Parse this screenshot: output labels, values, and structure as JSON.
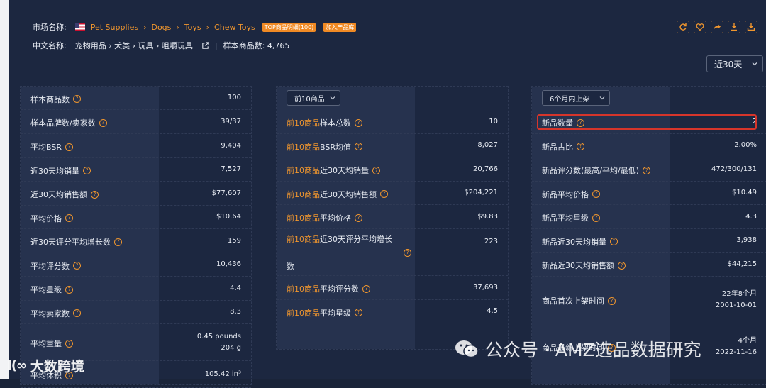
{
  "header": {
    "market_label": "市场名称:",
    "crumbs": [
      "Pet Supplies",
      "Dogs",
      "Toys",
      "Chew Toys"
    ],
    "crumb_sep": "›",
    "badge_top": "TOP商品明细(100)",
    "badge_add": "加入产品库",
    "cn_label": "中文名称:",
    "cn_path": "宠物用品 › 犬类 › 玩具 › 咀嚼玩具",
    "divider": "|",
    "sample_count_label": "样本商品数: 4,765"
  },
  "tools": [
    "refresh-icon",
    "heart-icon",
    "share-icon",
    "download-icon",
    "export-icon"
  ],
  "period": {
    "value": "近30天"
  },
  "col1": {
    "rows": [
      {
        "label": "样本商品数",
        "value": "100"
      },
      {
        "label": "样本品牌数/卖家数",
        "value": "39/37"
      },
      {
        "label": "平均BSR",
        "value": "9,404"
      },
      {
        "label": "近30天均销量",
        "value": "7,527"
      },
      {
        "label": "近30天均销售额",
        "value": "$77,607"
      },
      {
        "label": "平均价格",
        "value": "$10.64"
      },
      {
        "label": "近30天评分平均增长数",
        "value": "159"
      },
      {
        "label": "平均评分数",
        "value": "10,436"
      },
      {
        "label": "平均星级",
        "value": "4.4"
      },
      {
        "label": "平均卖家数",
        "value": "8.3"
      },
      {
        "label": "平均重量",
        "value": "0.45 pounds",
        "value2": "204 g"
      },
      {
        "label": "平均体积",
        "value": "105.42 in³"
      }
    ]
  },
  "col2": {
    "select": "前10商品",
    "prefix": "前10商品",
    "rows": [
      {
        "label": "样本总数",
        "value": "10"
      },
      {
        "label": "BSR均值",
        "value": "8,027"
      },
      {
        "label": "近30天均销量",
        "value": "20,766"
      },
      {
        "label": "近30天均销售额",
        "value": "$204,221"
      },
      {
        "label": "平均价格",
        "value": "$9.83"
      },
      {
        "label": "近30天评分平均增长",
        "label2": "数",
        "value": "223"
      },
      {
        "label": "平均评分数",
        "value": "37,693"
      },
      {
        "label": "平均星级",
        "value": "4.5"
      }
    ]
  },
  "col3": {
    "select": "6个月内上架",
    "rows": [
      {
        "label": "新品数量",
        "value": "2"
      },
      {
        "label": "新品占比",
        "value": "2.00%"
      },
      {
        "label": "新品评分数(最高/平均/最低)",
        "value": "472/300/131"
      },
      {
        "label": "新品平均价格",
        "value": "$10.49"
      },
      {
        "label": "新品平均星级",
        "value": "4.3"
      },
      {
        "label": "新品近30天均销量",
        "value": "3,938"
      },
      {
        "label": "新品近30天均销售额",
        "value": "$44,215"
      },
      {
        "label": "商品首次上架时间",
        "value": "22年8个月",
        "value2": "2001-10-01"
      },
      {
        "label": "商品最新上架时间",
        "value": "4个月",
        "value2": "2022-11-16"
      }
    ]
  },
  "watermark": {
    "left_logo": "I(∞",
    "left_text": "大数跨境",
    "right_text": "公众号 · AMZ选品数据研究"
  },
  "colors": {
    "accent": "#f0962e",
    "highlight_border": "#d6352b",
    "panel": "#1c2740"
  }
}
